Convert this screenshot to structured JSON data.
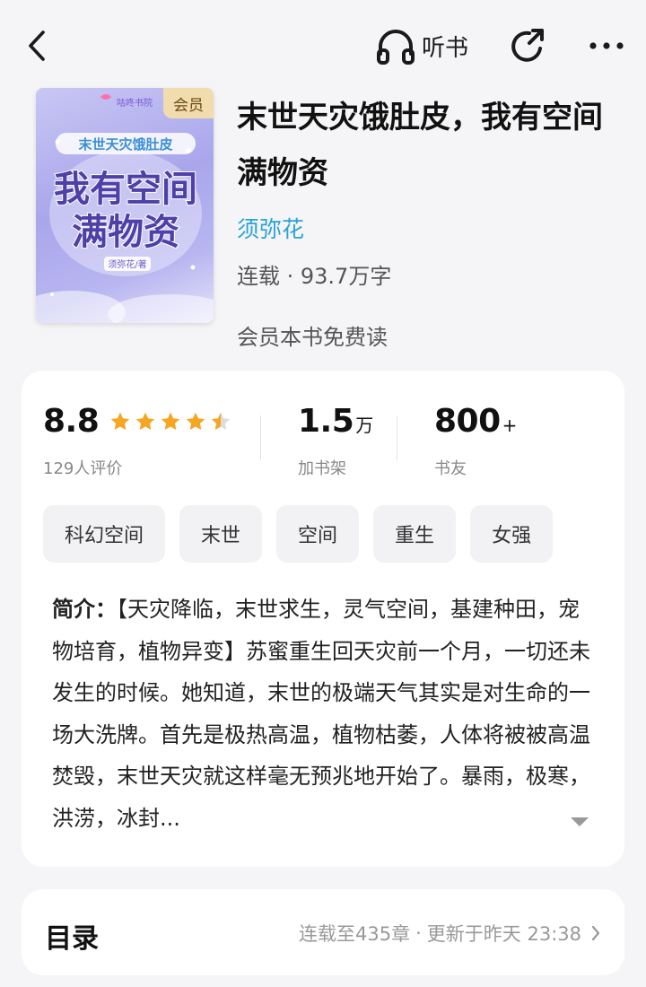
{
  "topbar": {
    "listen_label": "听书"
  },
  "book": {
    "cover": {
      "badge": "会员",
      "publisher_logo": "咕咚书院",
      "top_line": "末世天灾饿肚皮",
      "big_line1": "我有空间",
      "big_line2": "满物资",
      "author_stamp": "须弥花/著"
    },
    "title": "末世天灾饿肚皮，我有空间满物资",
    "author": "须弥花",
    "status": "连载 · 93.7万字",
    "free_note": "会员本书免费读"
  },
  "stats": {
    "rating": {
      "value": "8.8",
      "sub": "129人评价",
      "stars": 4.5
    },
    "shelf": {
      "value": "1.5",
      "unit": "万",
      "sub": "加书架"
    },
    "friends": {
      "value": "800",
      "unit": "+",
      "sub": "书友"
    }
  },
  "tags": [
    "科幻空间",
    "末世",
    "空间",
    "重生",
    "女强"
  ],
  "intro": {
    "label": "简介：",
    "text": "【天灾降临，末世求生，灵气空间，基建种田，宠物培育，植物异变】苏蜜重生回天灾前一个月，一切还未发生的时候。她知道，末世的极端天气其实是对生命的一场大洗牌。首先是极热高温，植物枯萎，人体将被被高温焚毁，末世天灾就这样毫无预兆地开始了。暴雨，极寒，洪涝，冰封..."
  },
  "catalog": {
    "title": "目录",
    "chapters": "连载至435章",
    "separator": "·",
    "updated": "更新于昨天 23:38"
  },
  "colors": {
    "accent_blue": "#2aa3d6",
    "star": "#f5a623",
    "vip_badge": "#f1dcae"
  }
}
